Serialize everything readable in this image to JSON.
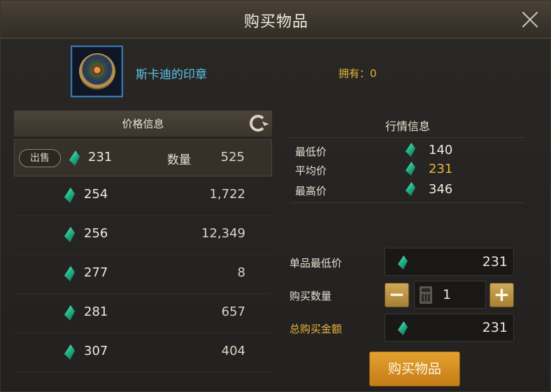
{
  "window": {
    "title": "购买物品"
  },
  "item": {
    "name": "斯卡迪的印章",
    "owned_label": "拥有：0"
  },
  "price_panel": {
    "header": "价格信息",
    "sell_label": "出售",
    "quantity_label": "数量",
    "rows": [
      {
        "price": "231",
        "qty": "525"
      },
      {
        "price": "254",
        "qty": "1,722"
      },
      {
        "price": "256",
        "qty": "12,349"
      },
      {
        "price": "277",
        "qty": "8"
      },
      {
        "price": "281",
        "qty": "657"
      },
      {
        "price": "307",
        "qty": "404"
      }
    ]
  },
  "market": {
    "title": "行情信息",
    "rows": [
      {
        "label": "最低价",
        "value": "140"
      },
      {
        "label": "平均价",
        "value": "231"
      },
      {
        "label": "最高价",
        "value": "346"
      }
    ]
  },
  "buy_form": {
    "unit_price_label": "单品最低价",
    "unit_price": "231",
    "quantity_label": "购买数量",
    "quantity": "1",
    "minus": "−",
    "plus": "+",
    "total_label": "总购买金额",
    "total": "231",
    "buy_button": "购买物品"
  },
  "icons": {
    "currency": "gem-icon",
    "refresh": "refresh-icon",
    "close": "close-icon",
    "calculator": "calculator-icon",
    "item": "seal-medal-icon"
  },
  "colors": {
    "accent_gold": "#e9b33a",
    "item_name": "#59c3e6",
    "buy_button": "#d8901f",
    "icon_border": "#3b78b8"
  }
}
